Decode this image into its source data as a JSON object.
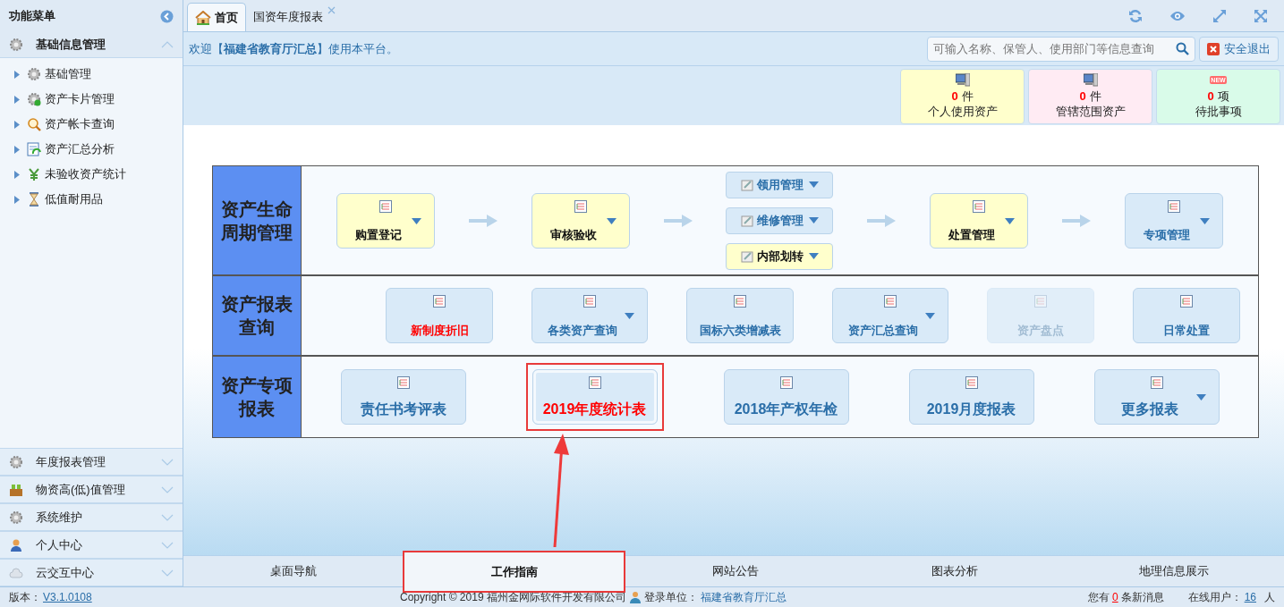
{
  "sidebar": {
    "title": "功能菜单",
    "groups": [
      {
        "label": "基础信息管理",
        "expanded": true,
        "items": [
          {
            "label": "基础管理"
          },
          {
            "label": "资产卡片管理"
          },
          {
            "label": "资产帐卡查询"
          },
          {
            "label": "资产汇总分析"
          },
          {
            "label": "未验收资产统计"
          },
          {
            "label": "低值耐用品"
          }
        ]
      },
      {
        "label": "年度报表管理",
        "expanded": false
      },
      {
        "label": "物资高(低)值管理",
        "expanded": false
      },
      {
        "label": "系统维护",
        "expanded": false
      },
      {
        "label": "个人中心",
        "expanded": false
      },
      {
        "label": "云交互中心",
        "expanded": false
      }
    ]
  },
  "tabs": [
    {
      "label": "首页",
      "selected": true,
      "closable": false
    },
    {
      "label": "国资年度报表",
      "selected": false,
      "closable": true
    }
  ],
  "welcome": "欢迎【**福建省教育厅汇总**】使用本平台。",
  "search": {
    "placeholder": "可输入名称、保管人、使用部门等信息查询"
  },
  "logout_button": "安全退出",
  "stat_cards": [
    {
      "count": "0",
      "unit": "件",
      "label": "个人使用资产",
      "color": "#ffffcc"
    },
    {
      "count": "0",
      "unit": "件",
      "label": "管辖范围资产",
      "color": "#ffebf3"
    },
    {
      "count": "0",
      "unit": "项",
      "label": "待批事项",
      "color": "#d9fbe9",
      "badge": "NEW"
    }
  ],
  "sections": [
    {
      "title": "资产生命周期管理",
      "items": [
        {
          "kind": "card",
          "label": "购置登记",
          "color": "#ffffcc",
          "dropdown": true,
          "highlight": false,
          "disabled": false,
          "marked": false
        },
        {
          "kind": "arrow"
        },
        {
          "kind": "card",
          "label": "审核验收",
          "color": "#ffffcc",
          "dropdown": true,
          "highlight": false,
          "disabled": false,
          "marked": false
        },
        {
          "kind": "arrow"
        },
        {
          "kind": "stack",
          "buttons": [
            {
              "label": "领用管理",
              "color": "#d9eaf8"
            },
            {
              "label": "维修管理",
              "color": "#d9eaf8"
            },
            {
              "label": "内部划转",
              "color": "#ffffcc"
            }
          ]
        },
        {
          "kind": "arrow"
        },
        {
          "kind": "card",
          "label": "处置管理",
          "color": "#ffffcc",
          "dropdown": true,
          "highlight": false,
          "disabled": false,
          "marked": false
        },
        {
          "kind": "arrow"
        },
        {
          "kind": "card",
          "label": "专项管理",
          "color": "#d9eaf8",
          "dropdown": true,
          "highlight": false,
          "disabled": false,
          "marked": false
        }
      ]
    },
    {
      "title": "资产报表查询",
      "items": [
        {
          "kind": "card",
          "label": "新制度折旧",
          "color": "#d9eaf8",
          "dropdown": false,
          "highlight": true,
          "disabled": false,
          "marked": false
        },
        {
          "kind": "card",
          "label": "各类资产查询",
          "color": "#d9eaf8",
          "dropdown": true,
          "highlight": false,
          "disabled": false,
          "marked": false
        },
        {
          "kind": "card",
          "label": "国标六类增减表",
          "color": "#d9eaf8",
          "dropdown": false,
          "highlight": false,
          "disabled": false,
          "marked": false
        },
        {
          "kind": "card",
          "label": "资产汇总查询",
          "color": "#d9eaf8",
          "dropdown": true,
          "highlight": false,
          "disabled": false,
          "marked": false
        },
        {
          "kind": "card",
          "label": "资产盘点",
          "color": "#d9eaf8",
          "dropdown": false,
          "highlight": false,
          "disabled": true,
          "marked": false
        },
        {
          "kind": "card",
          "label": "日常处置",
          "color": "#d9eaf8",
          "dropdown": false,
          "highlight": false,
          "disabled": false,
          "marked": false
        }
      ]
    },
    {
      "title": "资产专项报表",
      "items": [
        {
          "kind": "card",
          "label": "责任书考评表",
          "color": "#d9eaf8",
          "dropdown": false,
          "highlight": false,
          "disabled": false,
          "marked": false
        },
        {
          "kind": "card",
          "label": "2019年度统计表",
          "color": "#d9eaf8",
          "dropdown": false,
          "highlight": true,
          "disabled": false,
          "marked": true
        },
        {
          "kind": "card",
          "label": "2018年产权年检",
          "color": "#d9eaf8",
          "dropdown": false,
          "highlight": false,
          "disabled": false,
          "marked": false
        },
        {
          "kind": "card",
          "label": "2019月度报表",
          "color": "#d9eaf8",
          "dropdown": false,
          "highlight": false,
          "disabled": false,
          "marked": false
        },
        {
          "kind": "card",
          "label": "更多报表",
          "color": "#d9eaf8",
          "dropdown": true,
          "highlight": false,
          "disabled": false,
          "marked": false
        }
      ]
    }
  ],
  "bottom_tabs": [
    {
      "label": "桌面导航",
      "selected": false,
      "marked": false
    },
    {
      "label": "工作指南",
      "selected": true,
      "marked": true
    },
    {
      "label": "网站公告",
      "selected": false,
      "marked": false
    },
    {
      "label": "图表分析",
      "selected": false,
      "marked": false
    },
    {
      "label": "地理信息展示",
      "selected": false,
      "marked": false
    }
  ],
  "status_bar": {
    "version_label": "版本：",
    "version": "V3.1.0108",
    "copyright": "Copyright © 2019 福州金网际软件开发有限公司",
    "login_label": "登录单位：",
    "login_unit": "福建省教育厅汇总",
    "messages_prefix": "您有",
    "messages_count": "0",
    "messages_suffix": "条新消息",
    "online_label": "在线用户：",
    "online_count": "16",
    "online_suffix": "人"
  }
}
